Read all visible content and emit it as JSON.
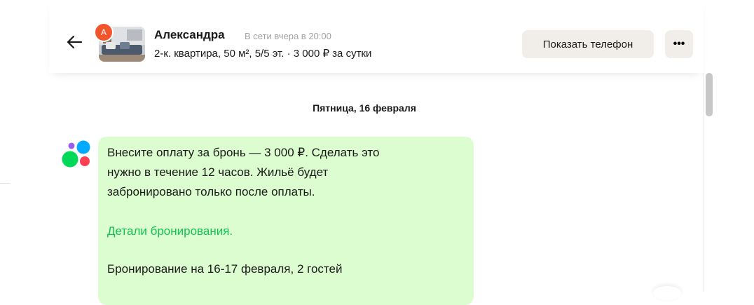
{
  "header": {
    "back_label": "back",
    "avatar_initial": "А",
    "name": "Александра",
    "status": "В сети вчера в 20:00",
    "listing_info": "2-к. квартира, 50 м², 5/5 эт. · 3 000 ₽ за сутки",
    "show_phone_label": "Показать телефон",
    "more_label": "•••"
  },
  "chat": {
    "date_separator": "Пятница, 16 февраля",
    "message": {
      "lines": [
        "Внесите оплату за бронь — 3 000 ₽. Сделать это",
        "нужно в течение 12 часов. Жильё будет",
        "забронировано только после оплаты."
      ],
      "link": "Детали бронирования.",
      "booking": "Бронирование на 16-17 февраля, 2 гостей"
    }
  },
  "colors": {
    "accent_green": "#13c153",
    "bubble_bg": "#dcfdcf",
    "button_bg": "#f1eee9",
    "avatar_bg": "#f2552c"
  }
}
